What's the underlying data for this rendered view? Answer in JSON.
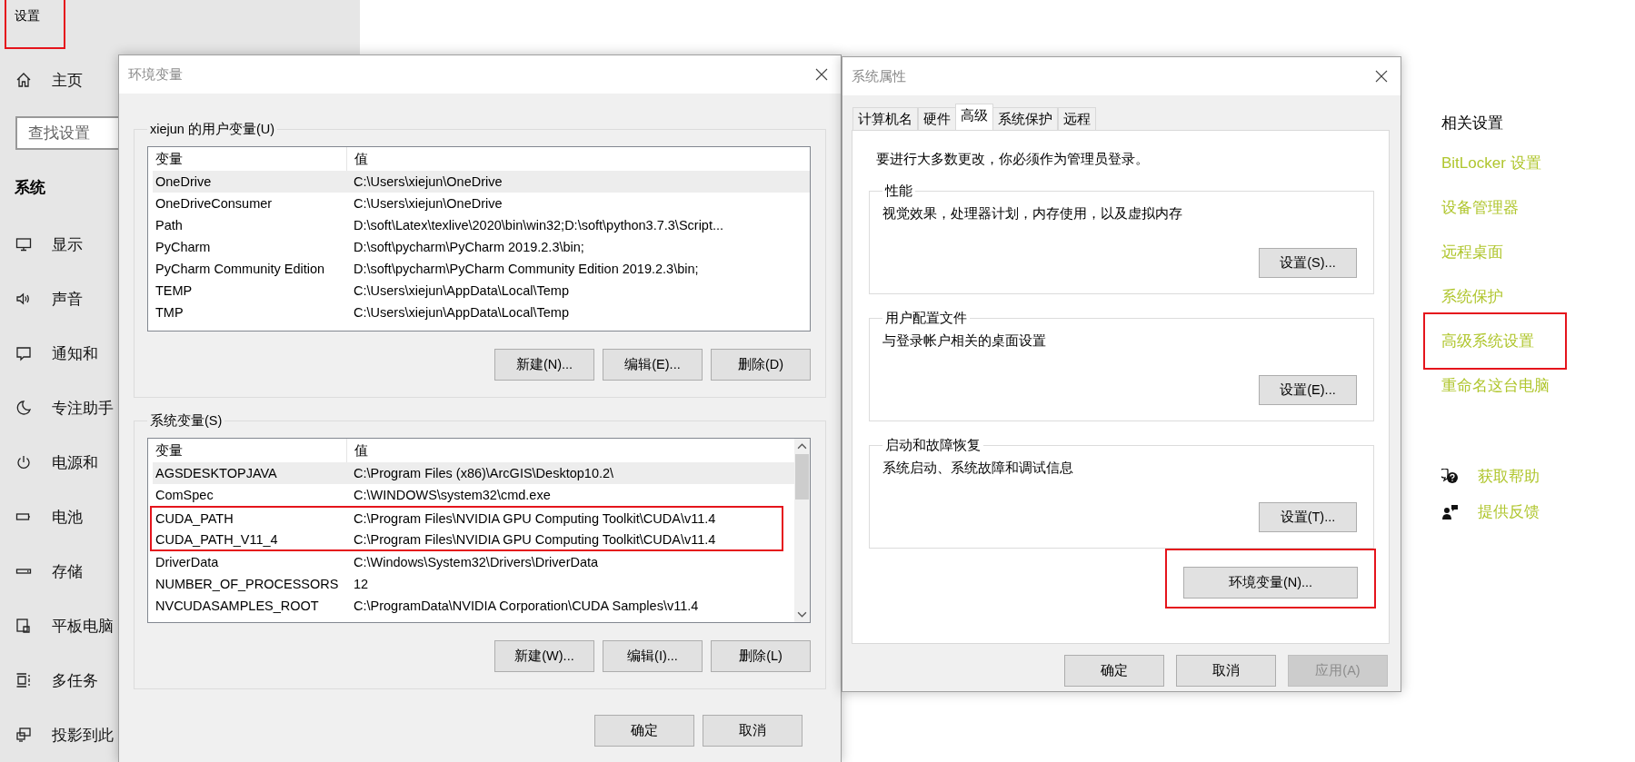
{
  "settings": {
    "title": "设置",
    "title_annotated": true,
    "home": "主页",
    "search": {
      "placeholder": "查找设置"
    },
    "section": "系统",
    "nav": [
      {
        "label": "显示",
        "kind": "display"
      },
      {
        "label": "声音",
        "kind": "sound"
      },
      {
        "label": "通知和",
        "kind": "notifications"
      },
      {
        "label": "专注助手",
        "kind": "focus"
      },
      {
        "label": "电源和",
        "kind": "power"
      },
      {
        "label": "电池",
        "kind": "battery"
      },
      {
        "label": "存储",
        "kind": "storage"
      },
      {
        "label": "平板电脑",
        "kind": "tablet"
      },
      {
        "label": "多任务",
        "kind": "multitask"
      },
      {
        "label": "投影到此",
        "kind": "project"
      }
    ]
  },
  "env_dialog": {
    "title": "环境变量",
    "groups": [
      {
        "legend": "xiejun 的用户变量(U)",
        "columns": [
          "变量",
          "值"
        ],
        "scrollbar": false,
        "rows": [
          {
            "name": "OneDrive",
            "value": "C:\\Users\\xiejun\\OneDrive",
            "selected": true,
            "annotated": false
          },
          {
            "name": "OneDriveConsumer",
            "value": "C:\\Users\\xiejun\\OneDrive",
            "selected": false,
            "annotated": false
          },
          {
            "name": "Path",
            "value": "D:\\soft\\Latex\\texlive\\2020\\bin\\win32;D:\\soft\\python3.7.3\\Script...",
            "selected": false,
            "annotated": false
          },
          {
            "name": "PyCharm",
            "value": "D:\\soft\\pycharm\\PyCharm 2019.2.3\\bin;",
            "selected": false,
            "annotated": false
          },
          {
            "name": "PyCharm Community Edition",
            "value": "D:\\soft\\pycharm\\PyCharm Community Edition 2019.2.3\\bin;",
            "selected": false,
            "annotated": false
          },
          {
            "name": "TEMP",
            "value": "C:\\Users\\xiejun\\AppData\\Local\\Temp",
            "selected": false,
            "annotated": false
          },
          {
            "name": "TMP",
            "value": "C:\\Users\\xiejun\\AppData\\Local\\Temp",
            "selected": false,
            "annotated": false
          }
        ],
        "buttons": [
          "新建(N)...",
          "编辑(E)...",
          "删除(D)"
        ]
      },
      {
        "legend": "系统变量(S)",
        "columns": [
          "变量",
          "值"
        ],
        "scrollbar": true,
        "rows": [
          {
            "name": "AGSDESKTOPJAVA",
            "value": "C:\\Program Files (x86)\\ArcGIS\\Desktop10.2\\",
            "selected": true,
            "annotated": false
          },
          {
            "name": "ComSpec",
            "value": "C:\\WINDOWS\\system32\\cmd.exe",
            "selected": false,
            "annotated": false
          },
          {
            "name": "CUDA_PATH",
            "value": "C:\\Program Files\\NVIDIA GPU Computing Toolkit\\CUDA\\v11.4",
            "selected": false,
            "annotated": true
          },
          {
            "name": "CUDA_PATH_V11_4",
            "value": "C:\\Program Files\\NVIDIA GPU Computing Toolkit\\CUDA\\v11.4",
            "selected": false,
            "annotated": true
          },
          {
            "name": "DriverData",
            "value": "C:\\Windows\\System32\\Drivers\\DriverData",
            "selected": false,
            "annotated": false
          },
          {
            "name": "NUMBER_OF_PROCESSORS",
            "value": "12",
            "selected": false,
            "annotated": false
          },
          {
            "name": "NVCUDASAMPLES_ROOT",
            "value": "C:\\ProgramData\\NVIDIA Corporation\\CUDA Samples\\v11.4",
            "selected": false,
            "annotated": false
          }
        ],
        "buttons": [
          "新建(W)...",
          "编辑(I)...",
          "删除(L)"
        ]
      }
    ],
    "buttons": [
      "确定",
      "取消"
    ]
  },
  "system_properties": {
    "title": "系统属性",
    "tabs": [
      {
        "label": "计算机名",
        "selected": false
      },
      {
        "label": "硬件",
        "selected": false
      },
      {
        "label": "高级",
        "selected": true
      },
      {
        "label": "系统保护",
        "selected": false
      },
      {
        "label": "远程",
        "selected": false
      }
    ],
    "notice": "要进行大多数更改，你必须作为管理员登录。",
    "groups": [
      {
        "legend": "性能",
        "description": "视觉效果，处理器计划，内存使用，以及虚拟内存",
        "button": "设置(S)..."
      },
      {
        "legend": "用户配置文件",
        "description": "与登录帐户相关的桌面设置",
        "button": "设置(E)..."
      },
      {
        "legend": "启动和故障恢复",
        "description": "系统启动、系统故障和调试信息",
        "button": "设置(T)..."
      }
    ],
    "env_button": {
      "label": "环境变量(N)...",
      "annotated": true
    },
    "buttons": [
      {
        "label": "确定",
        "disabled": false
      },
      {
        "label": "取消",
        "disabled": false
      },
      {
        "label": "应用(A)",
        "disabled": true
      }
    ]
  },
  "related": {
    "heading": "相关设置",
    "links": [
      {
        "label": "BitLocker 设置",
        "annotated": false
      },
      {
        "label": "设备管理器",
        "annotated": false
      },
      {
        "label": "远程桌面",
        "annotated": false
      },
      {
        "label": "系统保护",
        "annotated": false
      },
      {
        "label": "高级系统设置",
        "annotated": true
      },
      {
        "label": "重命名这台电脑",
        "annotated": false
      }
    ],
    "help": [
      {
        "label": "获取帮助",
        "kind": "help"
      },
      {
        "label": "提供反馈",
        "kind": "feedback"
      }
    ]
  }
}
